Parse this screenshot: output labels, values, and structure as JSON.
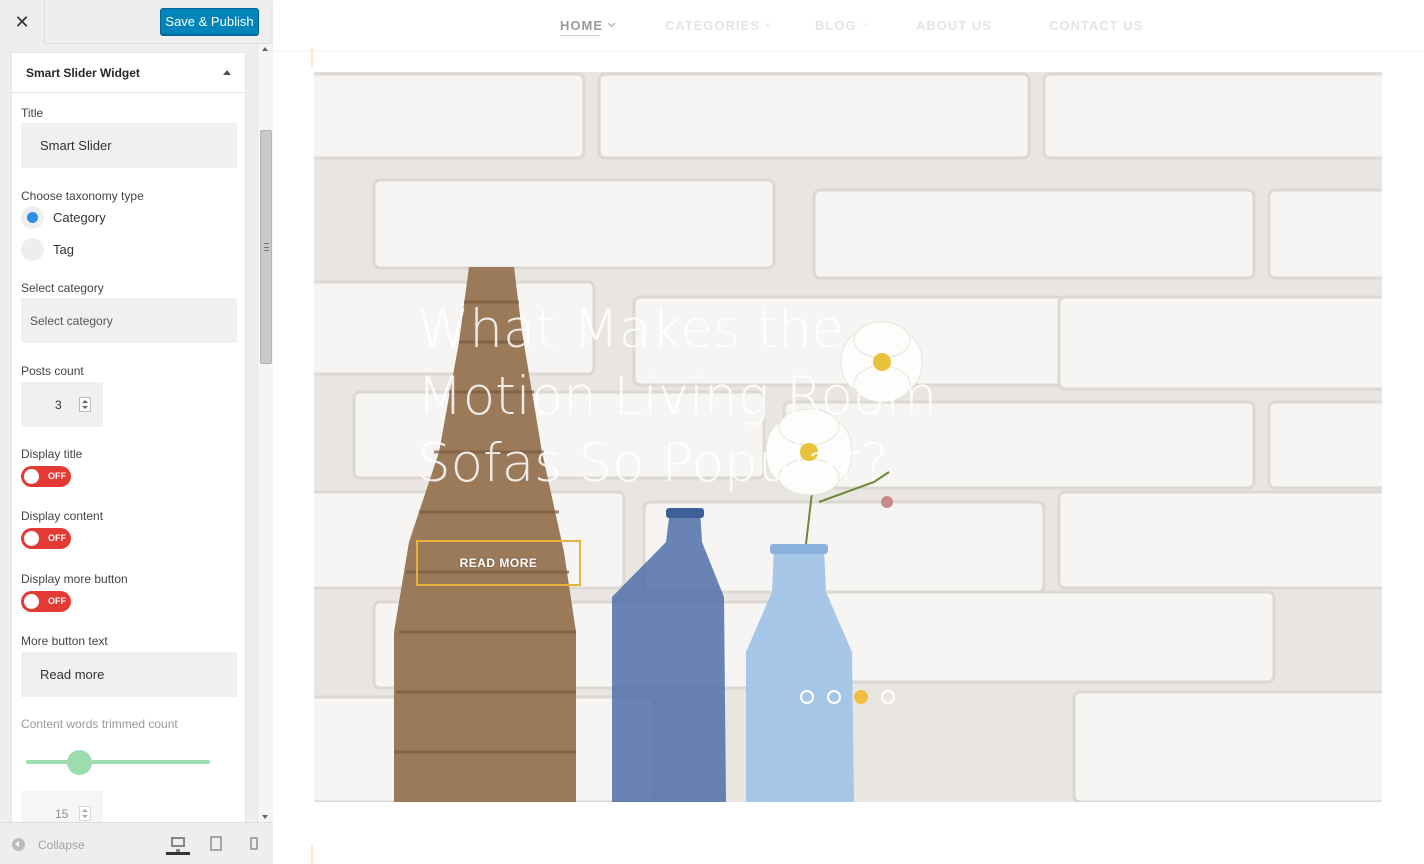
{
  "header": {
    "close_icon": "close-icon",
    "publish_label": "Save & Publish"
  },
  "widget": {
    "title": "Smart Slider Widget",
    "title_label": "Title",
    "title_value": "Smart Slider",
    "taxonomy_label": "Choose taxonomy type",
    "taxonomy_options": [
      {
        "label": "Category",
        "selected": true
      },
      {
        "label": "Tag",
        "selected": false
      }
    ],
    "category_label": "Select category",
    "category_placeholder": "Select category",
    "posts_count_label": "Posts count",
    "posts_count_value": "3",
    "display_title_label": "Display title",
    "display_content_label": "Display content",
    "display_more_label": "Display more button",
    "toggle_off": "OFF",
    "more_text_label": "More button text",
    "more_text_value": "Read more",
    "trim_label": "Content words trimmed count",
    "trim_value": "15",
    "trim_slider_fraction": 0.22
  },
  "footer": {
    "collapse_label": "Collapse",
    "devices": [
      "desktop-icon",
      "tablet-icon",
      "mobile-icon"
    ]
  },
  "nav": {
    "items": [
      "HOME",
      "CATEGORIES",
      "BLOG",
      "ABOUT US",
      "CONTACT US"
    ]
  },
  "hero": {
    "title": "What Makes the Motion Living Room Sofas So Popular?",
    "button": "READ MORE",
    "slides": 4,
    "active_slide": 3
  },
  "colors": {
    "accent": "#0085ba",
    "toggle_off": "#e53935",
    "slider": "#9ddcae",
    "gold": "#f0bf42"
  }
}
